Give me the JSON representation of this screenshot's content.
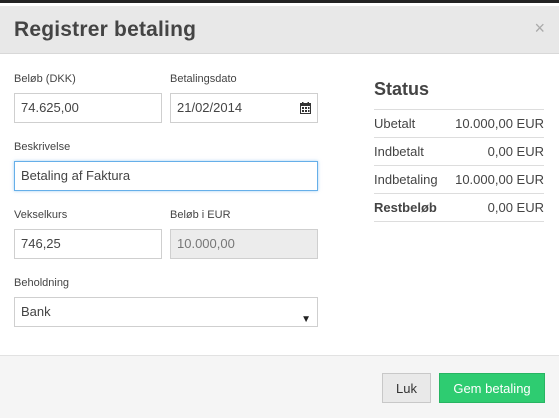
{
  "modal": {
    "title": "Registrer betaling",
    "close_symbol": "×"
  },
  "form": {
    "amount": {
      "label": "Beløb (DKK)",
      "value": "74.625,00"
    },
    "payment_date": {
      "label": "Betalingsdato",
      "value": "21/02/2014",
      "icon": "calendar-icon"
    },
    "description": {
      "label": "Beskrivelse",
      "value": "Betaling af Faktura"
    },
    "exchange_rate": {
      "label": "Vekselkurs",
      "value": "746,25"
    },
    "amount_eur": {
      "label": "Beløb i EUR",
      "value": "10.000,00"
    },
    "holding": {
      "label": "Beholdning",
      "value": "Bank",
      "caret": "▼"
    }
  },
  "status": {
    "title": "Status",
    "rows": [
      {
        "key": "Ubetalt",
        "value": "10.000,00 EUR"
      },
      {
        "key": "Indbetalt",
        "value": "0,00 EUR"
      },
      {
        "key": "Indbetaling",
        "value": "10.000,00 EUR"
      },
      {
        "key": "Restbeløb",
        "value": "0,00 EUR"
      }
    ]
  },
  "footer": {
    "close_label": "Luk",
    "save_label": "Gem betaling"
  },
  "colors": {
    "save_button": "#2ecc71",
    "focus_border": "#66afe9",
    "header_bg": "#e8e8e8"
  }
}
